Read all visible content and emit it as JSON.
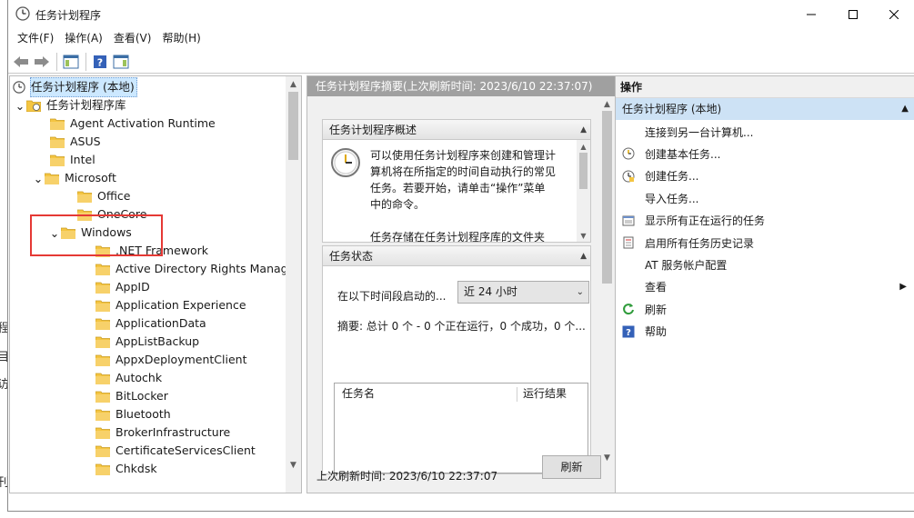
{
  "window": {
    "title": "任务计划程序",
    "controls": {
      "minimize": "minimize-icon",
      "maximize": "maximize-icon",
      "close": "close-icon"
    }
  },
  "menubar": {
    "items": [
      {
        "label": "文件(F)"
      },
      {
        "label": "操作(A)"
      },
      {
        "label": "查看(V)"
      },
      {
        "label": "帮助(H)"
      }
    ]
  },
  "toolbar": {
    "buttons": [
      "back-icon",
      "forward-icon",
      "show-hide-console-tree-icon",
      "help-icon",
      "show-hide-action-pane-icon"
    ]
  },
  "tree": {
    "root": "任务计划程序 (本地)",
    "library": "任务计划程序库",
    "items": [
      {
        "label": "Agent Activation Runtime"
      },
      {
        "label": "ASUS"
      },
      {
        "label": "Intel"
      },
      {
        "label": "Microsoft"
      },
      {
        "label": "Office"
      },
      {
        "label": "OneCore"
      },
      {
        "label": "Windows"
      },
      {
        "label": ".NET Framework"
      },
      {
        "label": "Active Directory Rights Manageme"
      },
      {
        "label": "AppID"
      },
      {
        "label": "Application Experience"
      },
      {
        "label": "ApplicationData"
      },
      {
        "label": "AppListBackup"
      },
      {
        "label": "AppxDeploymentClient"
      },
      {
        "label": "Autochk"
      },
      {
        "label": "BitLocker"
      },
      {
        "label": "Bluetooth"
      },
      {
        "label": "BrokerInfrastructure"
      },
      {
        "label": "CertificateServicesClient"
      },
      {
        "label": "Chkdsk"
      }
    ]
  },
  "middle": {
    "header": "任务计划程序摘要(上次刷新时间: 2023/6/10 22:37:07)",
    "overview": {
      "title": "任务计划程序概述",
      "text_lines": [
        "可以使用任务计划程序来创建和管理计",
        "算机将在所指定的时间自动执行的常见",
        "任务。若要开始，请单击“操作”菜单",
        "中的命令。",
        "",
        "任务存储在任务计划程序库的文件夹"
      ]
    },
    "status": {
      "title": "任务状态",
      "period_label": "在以下时间段启动的...",
      "period_value": "近 24 小时",
      "summary": "摘要: 总计 0 个 - 0 个正在运行，0 个成功，0 个...",
      "columns": [
        "任务名",
        "运行结果"
      ]
    },
    "footer": {
      "last_refresh": "上次刷新时间: 2023/6/10 22:37:07",
      "refresh_button": "刷新"
    }
  },
  "actions": {
    "header": "操作",
    "group": "任务计划程序 (本地)",
    "items": [
      {
        "label": "连接到另一台计算机...",
        "icon": ""
      },
      {
        "label": "创建基本任务...",
        "icon": "create-basic-task-icon"
      },
      {
        "label": "创建任务...",
        "icon": "create-task-icon"
      },
      {
        "label": "导入任务...",
        "icon": ""
      },
      {
        "label": "显示所有正在运行的任务",
        "icon": "running-tasks-icon"
      },
      {
        "label": "启用所有任务历史记录",
        "icon": "history-icon"
      },
      {
        "label": "AT 服务帐户配置",
        "icon": ""
      },
      {
        "label": "查看",
        "icon": ""
      },
      {
        "label": "刷新",
        "icon": "refresh-icon"
      },
      {
        "label": "帮助",
        "icon": "help-icon"
      }
    ]
  },
  "colors": {
    "selection": "#cce8ff",
    "group_header": "#cde2f5",
    "folder": "#f4c542",
    "highlight_box": "#e53935"
  }
}
